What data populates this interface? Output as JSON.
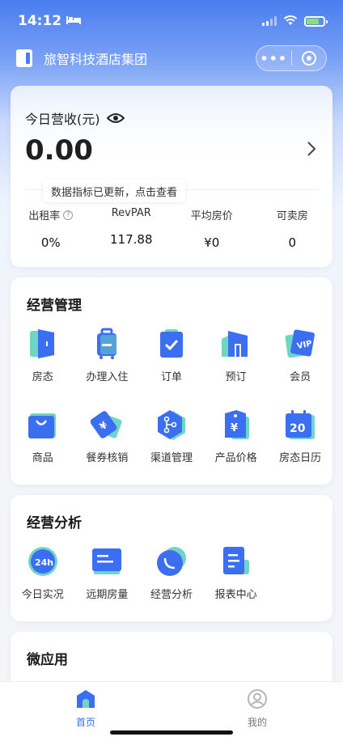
{
  "status_bar": {
    "time": "14:12"
  },
  "nav": {
    "title": "旅智科技酒店集团",
    "more_label": "•••"
  },
  "revenue": {
    "label": "今日营收(元)",
    "value": "0.00",
    "toast": "数据指标已更新，点击查看",
    "metrics": [
      {
        "label": "出租率",
        "value": "0%"
      },
      {
        "label": "RevPAR",
        "value": "117.88"
      },
      {
        "label": "平均房价",
        "value": "¥0"
      },
      {
        "label": "可卖房",
        "value": "0"
      }
    ]
  },
  "management": {
    "title": "经营管理",
    "items": [
      {
        "label": "房态",
        "icon": "door-icon"
      },
      {
        "label": "办理入住",
        "icon": "luggage-icon"
      },
      {
        "label": "订单",
        "icon": "clipboard-check-icon"
      },
      {
        "label": "预订",
        "icon": "building-icon"
      },
      {
        "label": "会员",
        "icon": "vip-card-icon"
      },
      {
        "label": "商品",
        "icon": "shopping-bag-icon"
      },
      {
        "label": "餐券核销",
        "icon": "yen-ticket-icon"
      },
      {
        "label": "渠道管理",
        "icon": "channel-hexagon-icon"
      },
      {
        "label": "产品价格",
        "icon": "price-tag-icon"
      },
      {
        "label": "房态日历",
        "icon": "calendar-icon"
      }
    ],
    "calendar_day": "20"
  },
  "analysis": {
    "title": "经营分析",
    "items": [
      {
        "label": "今日实况",
        "icon": "24h-icon"
      },
      {
        "label": "远期房量",
        "icon": "forward-volume-icon"
      },
      {
        "label": "经营分析",
        "icon": "pie-chart-icon"
      },
      {
        "label": "报表中心",
        "icon": "report-icon"
      }
    ],
    "clock_text": "24h"
  },
  "micro": {
    "title": "微应用"
  },
  "tabs": [
    {
      "label": "首页",
      "active": true
    },
    {
      "label": "我的",
      "active": false
    }
  ],
  "colors": {
    "primary": "#3b6ef0",
    "accent_teal": "#6fd6c6",
    "text": "#1f1f1f"
  }
}
